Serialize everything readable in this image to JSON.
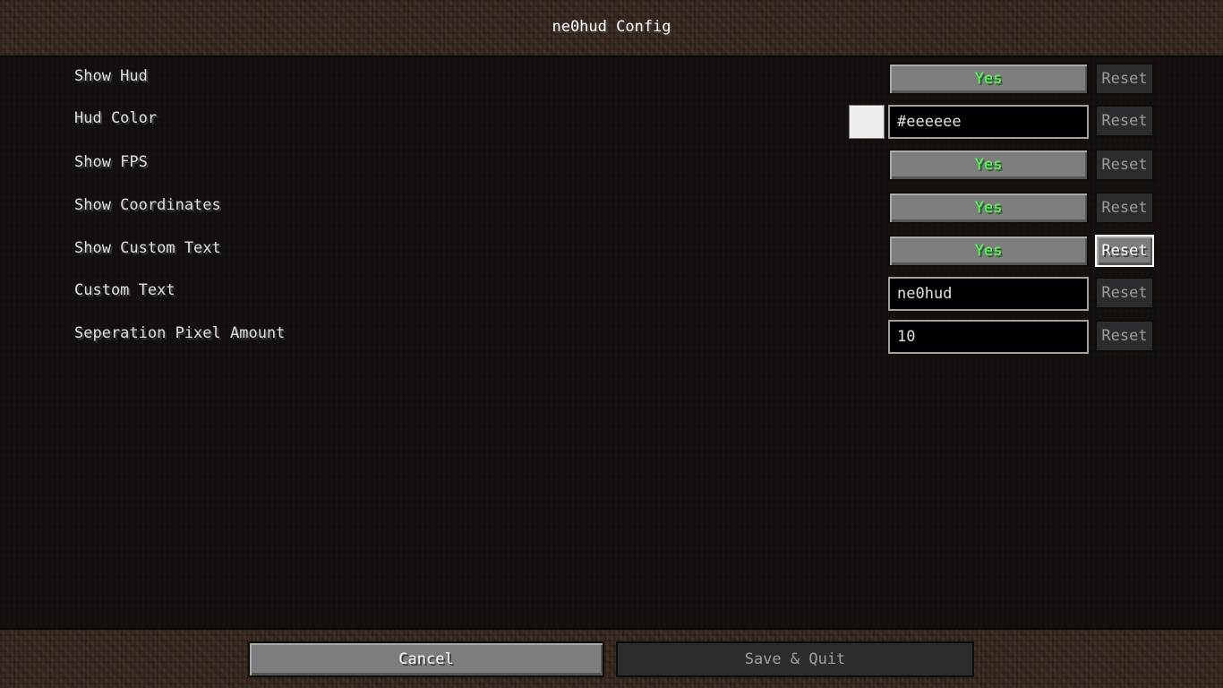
{
  "title": "ne0hud Config",
  "accent_colors": {
    "toggle_on_text": "#55ff55",
    "swatch": "#eeeeee"
  },
  "options": [
    {
      "label": "Show Hud",
      "type": "toggle",
      "value": "Yes",
      "reset": "Reset"
    },
    {
      "label": "Hud Color",
      "type": "color",
      "value": "#eeeeee",
      "reset": "Reset"
    },
    {
      "label": "Show FPS",
      "type": "toggle",
      "value": "Yes",
      "reset": "Reset"
    },
    {
      "label": "Show Coordinates",
      "type": "toggle",
      "value": "Yes",
      "reset": "Reset"
    },
    {
      "label": "Show Custom Text",
      "type": "toggle",
      "value": "Yes",
      "reset": "Reset"
    },
    {
      "label": "Custom Text",
      "type": "text",
      "value": "ne0hud",
      "reset": "Reset"
    },
    {
      "label": "Seperation Pixel Amount",
      "type": "text",
      "value": "10",
      "reset": "Reset"
    }
  ],
  "footer": {
    "cancel_label": "Cancel",
    "save_label": "Save & Quit"
  }
}
